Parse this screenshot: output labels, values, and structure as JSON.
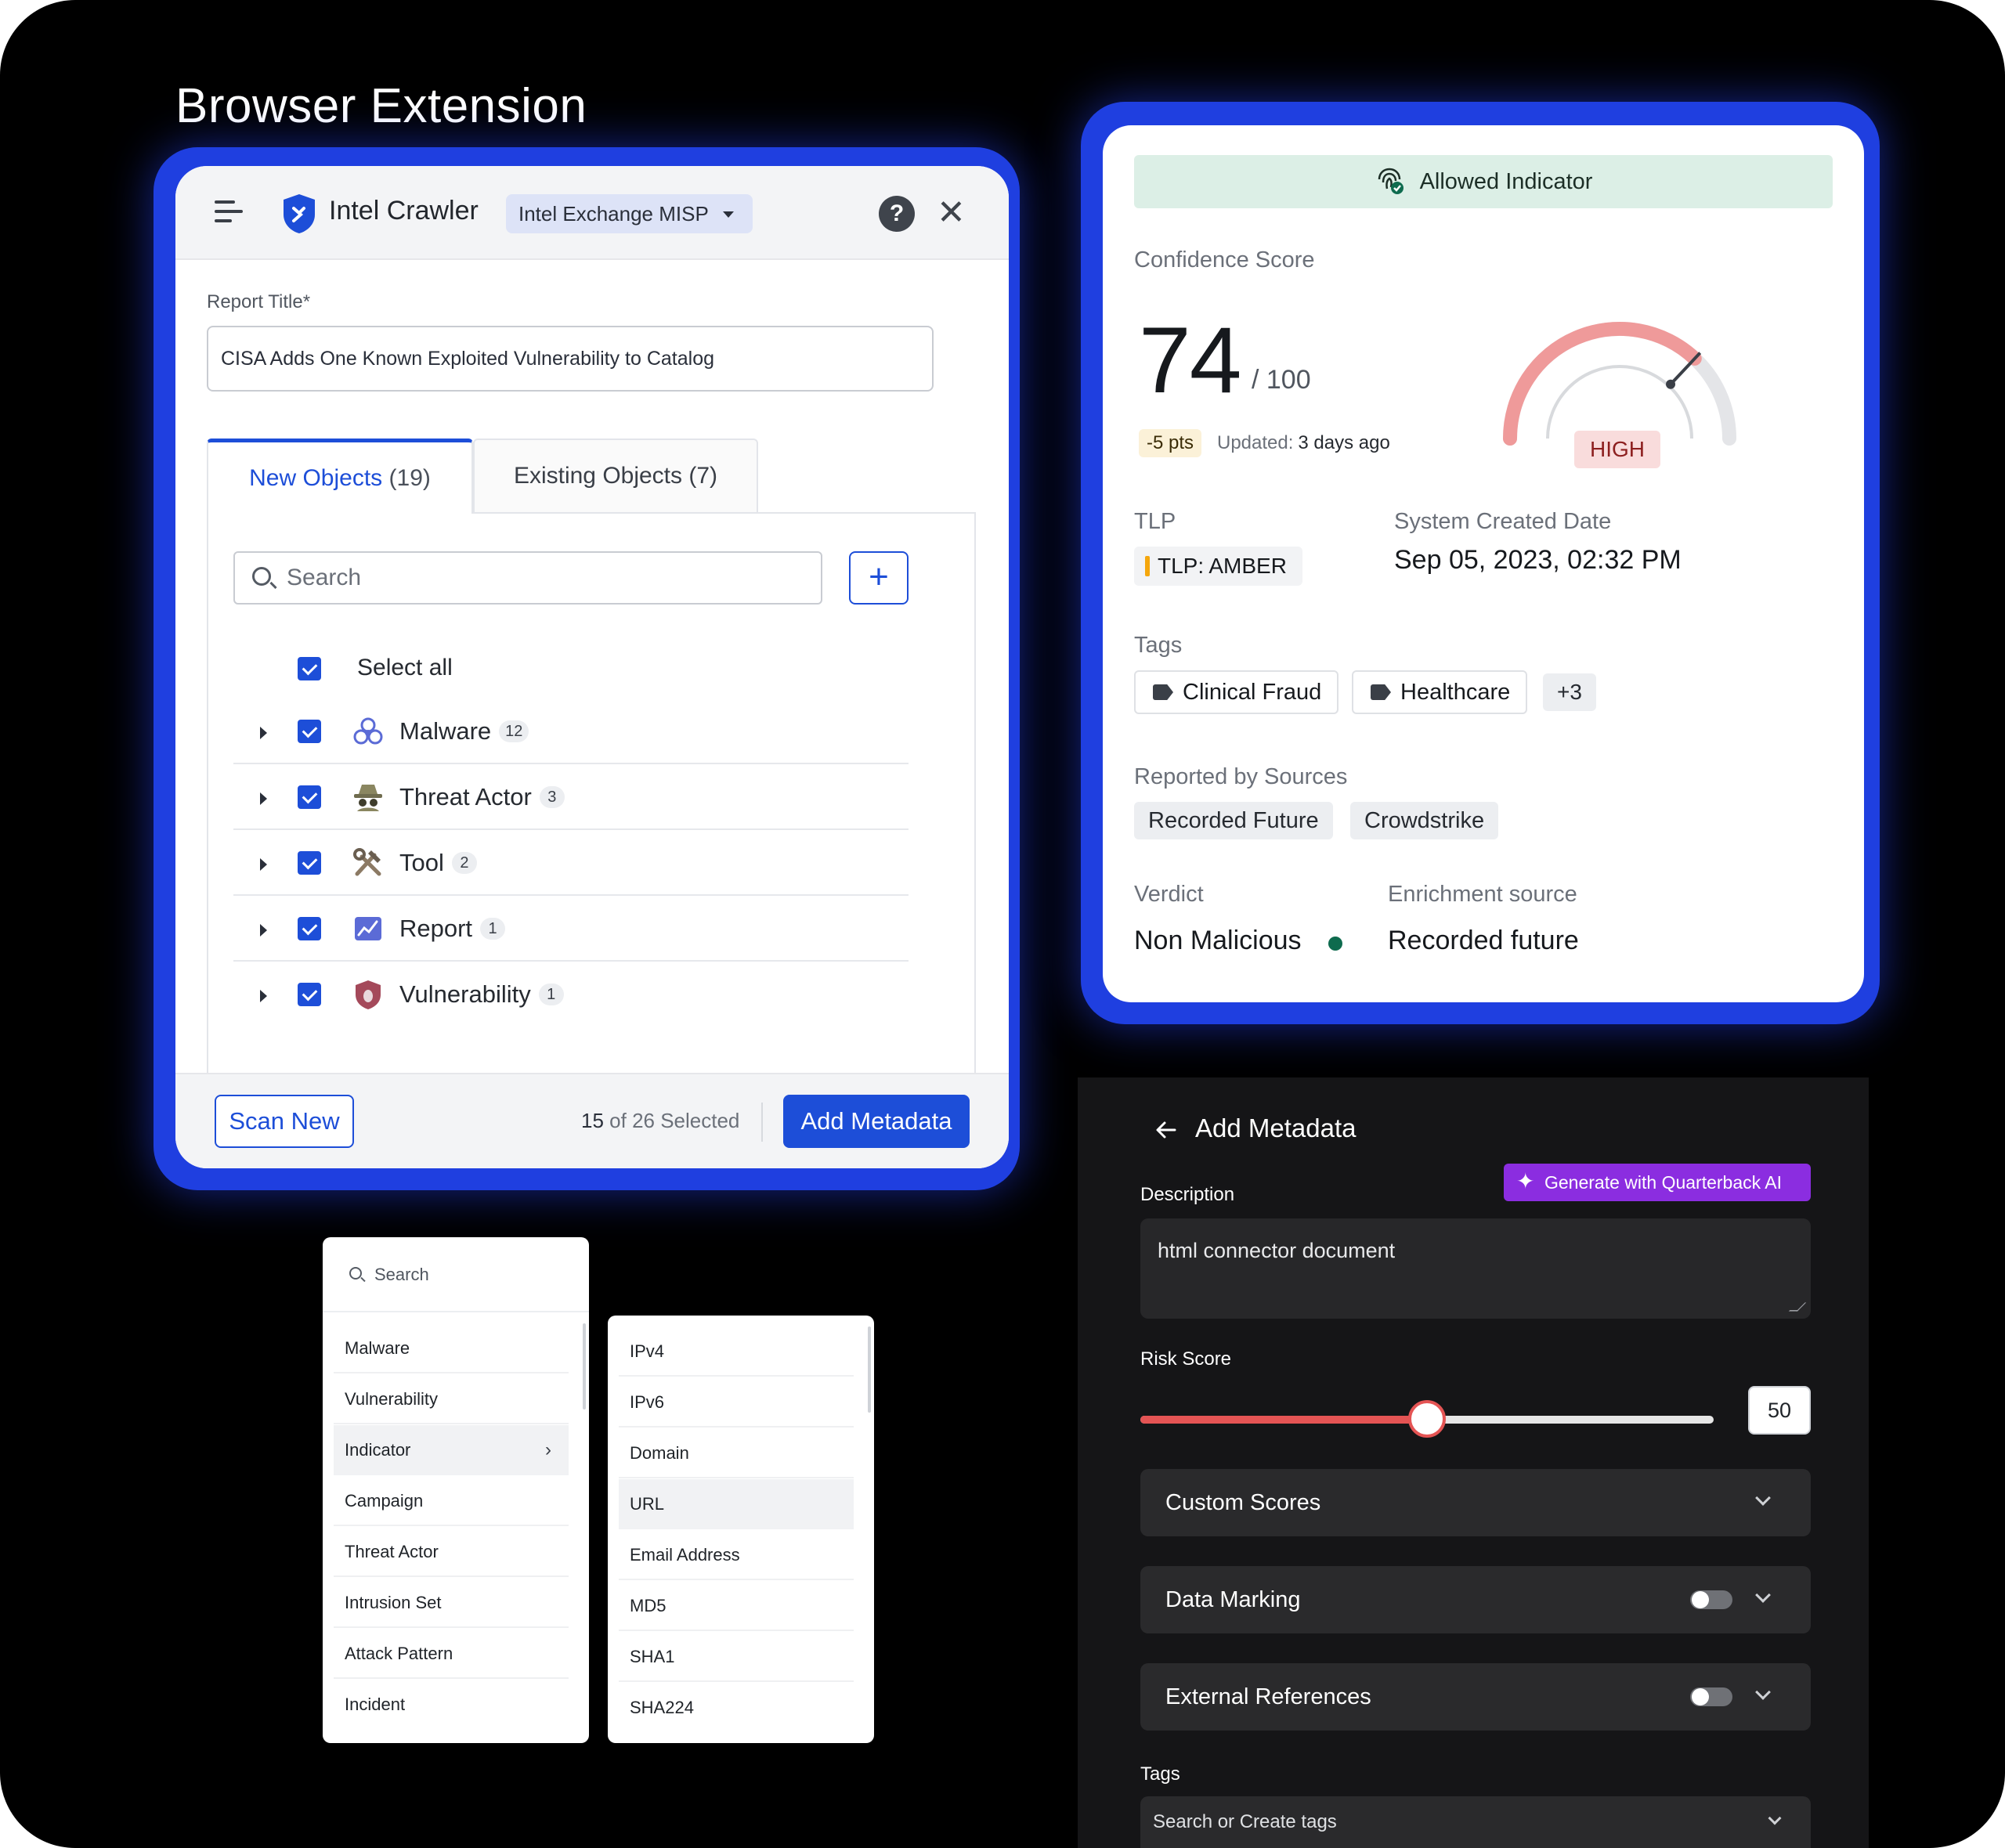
{
  "page_title": "Browser Extension",
  "crawler": {
    "app_name": "Intel Crawler",
    "workspace": "Intel Exchange MISP",
    "help_label": "?",
    "close_label": "✕",
    "report_title_label": "Report Title*",
    "report_title_value": "CISA Adds One Known Exploited Vulnerability to Catalog",
    "tabs": [
      {
        "label": "New Objects",
        "count": "(19)"
      },
      {
        "label": "Existing Objects",
        "count": "(7)"
      }
    ],
    "search_placeholder": "Search",
    "add_label": "+",
    "select_all": "Select all",
    "objects": [
      {
        "label": "Malware",
        "count": "12",
        "icon": "biohazard-icon"
      },
      {
        "label": "Threat Actor",
        "count": "3",
        "icon": "spy-icon"
      },
      {
        "label": "Tool",
        "count": "2",
        "icon": "tools-icon"
      },
      {
        "label": "Report",
        "count": "1",
        "icon": "chart-icon"
      },
      {
        "label": "Vulnerability",
        "count": "1",
        "icon": "shield-bug-icon"
      }
    ],
    "scan_new": "Scan New",
    "selected_count": "15",
    "selected_total": "of 26 Selected",
    "add_metadata": "Add Metadata"
  },
  "indicator": {
    "status": "Allowed Indicator",
    "confidence_label": "Confidence Score",
    "score": "74",
    "score_max": "/ 100",
    "score_fraction": 0.74,
    "delta": "-5 pts",
    "updated_label": "Updated:",
    "updated_value": "3 days ago",
    "level": "HIGH",
    "tlp_label": "TLP",
    "tlp_value": "TLP: AMBER",
    "created_label": "System Created Date",
    "created_value": "Sep 05, 2023, 02:32 PM",
    "tags_label": "Tags",
    "tags": [
      "Clinical Fraud",
      "Healthcare"
    ],
    "tags_more": "+3",
    "sources_label": "Reported by Sources",
    "sources": [
      "Recorded Future",
      "Crowdstrike"
    ],
    "verdict_label": "Verdict",
    "verdict_value": "Non Malicious",
    "enrichment_label": "Enrichment source",
    "enrichment_value": "Recorded future",
    "colors": {
      "gauge": "#ef9a9a",
      "verdict_dot": "#0e6b4e",
      "tlp": "#f5a70d"
    }
  },
  "type_menu": {
    "search_placeholder": "Search",
    "items": [
      "Malware",
      "Vulnerability",
      "Indicator",
      "Campaign",
      "Threat Actor",
      "Intrusion Set",
      "Attack Pattern",
      "Incident"
    ],
    "active": "Indicator"
  },
  "subtype_menu": {
    "items": [
      "IPv4",
      "IPv6",
      "Domain",
      "URL",
      "Email Address",
      "MD5",
      "SHA1",
      "SHA224"
    ],
    "active": "URL"
  },
  "metadata": {
    "title": "Add Metadata",
    "ai_button": "Generate with Quarterback AI",
    "description_label": "Description",
    "description_value": "html connector document",
    "risk_label": "Risk Score",
    "risk_value": "50",
    "risk_fraction": 0.5,
    "sections": [
      "Custom Scores",
      "Data Marking",
      "External References"
    ],
    "tags_label": "Tags",
    "tags_placeholder": "Search or Create tags"
  }
}
